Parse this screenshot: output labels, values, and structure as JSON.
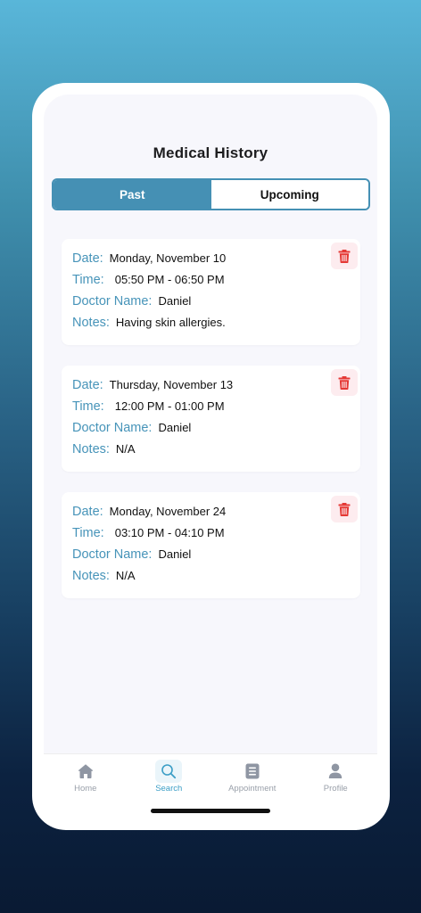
{
  "header": {
    "title": "Medical History"
  },
  "segments": {
    "past": "Past",
    "upcoming": "Upcoming",
    "active": "past"
  },
  "labels": {
    "date": "Date:",
    "time": "Time:",
    "doctor": "Doctor Name:",
    "notes": "Notes:"
  },
  "appointments": [
    {
      "date": "Monday, November 10",
      "time": "05:50 PM - 06:50 PM",
      "doctor": "Daniel",
      "notes": "Having skin allergies."
    },
    {
      "date": "Thursday, November 13",
      "time": "12:00 PM - 01:00 PM",
      "doctor": "Daniel",
      "notes": "N/A"
    },
    {
      "date": "Monday, November 24",
      "time": "03:10 PM - 04:10 PM",
      "doctor": "Daniel",
      "notes": "N/A"
    }
  ],
  "tabbar": {
    "items": [
      {
        "label": "Home",
        "icon": "home-icon",
        "active": false
      },
      {
        "label": "Search",
        "icon": "search-icon",
        "active": true
      },
      {
        "label": "Appointment",
        "icon": "document-icon",
        "active": false
      },
      {
        "label": "Profile",
        "icon": "person-icon",
        "active": false
      }
    ]
  },
  "colors": {
    "accent": "#4590b4",
    "label": "#4794b9",
    "delete": "#e53935",
    "delete_bg": "#fdecef",
    "tab_active": "#3b9ec6",
    "tab_inactive": "#9aa0aa"
  }
}
